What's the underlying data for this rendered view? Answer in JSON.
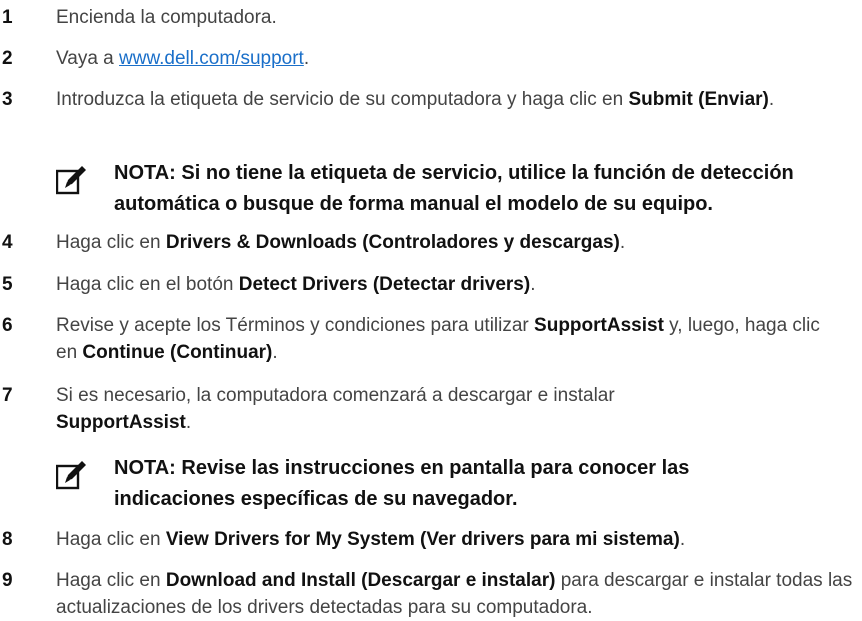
{
  "steps": [
    {
      "num": "1",
      "parts": [
        {
          "t": "Encienda la computadora."
        }
      ]
    },
    {
      "num": "2",
      "parts": [
        {
          "t": "Vaya a "
        },
        {
          "t": "www.dell.com/support",
          "link": true
        },
        {
          "t": "."
        }
      ]
    },
    {
      "num": "3",
      "parts": [
        {
          "t": "Introduzca la etiqueta de servicio de su computadora y haga clic en "
        },
        {
          "t": "Submit (Enviar)",
          "b": true
        },
        {
          "t": "."
        }
      ]
    },
    {
      "num": "4",
      "parts": [
        {
          "t": "Haga clic en "
        },
        {
          "t": "Drivers & Downloads (Controladores y descargas)",
          "b": true
        },
        {
          "t": "."
        }
      ]
    },
    {
      "num": "5",
      "parts": [
        {
          "t": "Haga clic en el botón "
        },
        {
          "t": "Detect Drivers (Detectar drivers)",
          "b": true
        },
        {
          "t": "."
        }
      ]
    },
    {
      "num": "6",
      "parts": [
        {
          "t": "Revise y acepte los Términos y condiciones para utilizar "
        },
        {
          "t": "SupportAssist",
          "b": true
        },
        {
          "t": " y, luego, haga clic en "
        },
        {
          "t": "Continue (Continuar)",
          "b": true
        },
        {
          "t": "."
        }
      ]
    },
    {
      "num": "7",
      "parts": [
        {
          "t": "Si es necesario, la computadora comenzará a descargar e instalar "
        },
        {
          "t": "SupportAssist",
          "b": true
        },
        {
          "t": "."
        }
      ]
    },
    {
      "num": "8",
      "parts": [
        {
          "t": "Haga clic en "
        },
        {
          "t": "View Drivers for My System (Ver drivers para mi sistema)",
          "b": true
        },
        {
          "t": "."
        }
      ]
    },
    {
      "num": "9",
      "parts": [
        {
          "t": "Haga clic en "
        },
        {
          "t": "Download and Install (Descargar e instalar)",
          "b": true
        },
        {
          "t": " para descargar e instalar todas las actualizaciones de los drivers detectadas para su computadora."
        }
      ]
    }
  ],
  "notes": {
    "note1": "NOTA: Si no tiene la etiqueta de servicio, utilice la función de detección automática o busque de forma manual el modelo de su equipo.",
    "note2": "NOTA: Revise las instrucciones en pantalla para conocer las indicaciones específicas de su navegador."
  },
  "icons": {
    "note_icon": "pencil-note-icon"
  },
  "colors": {
    "link": "#1a6fc9",
    "body_text": "#444444",
    "bold_text": "#111111"
  }
}
